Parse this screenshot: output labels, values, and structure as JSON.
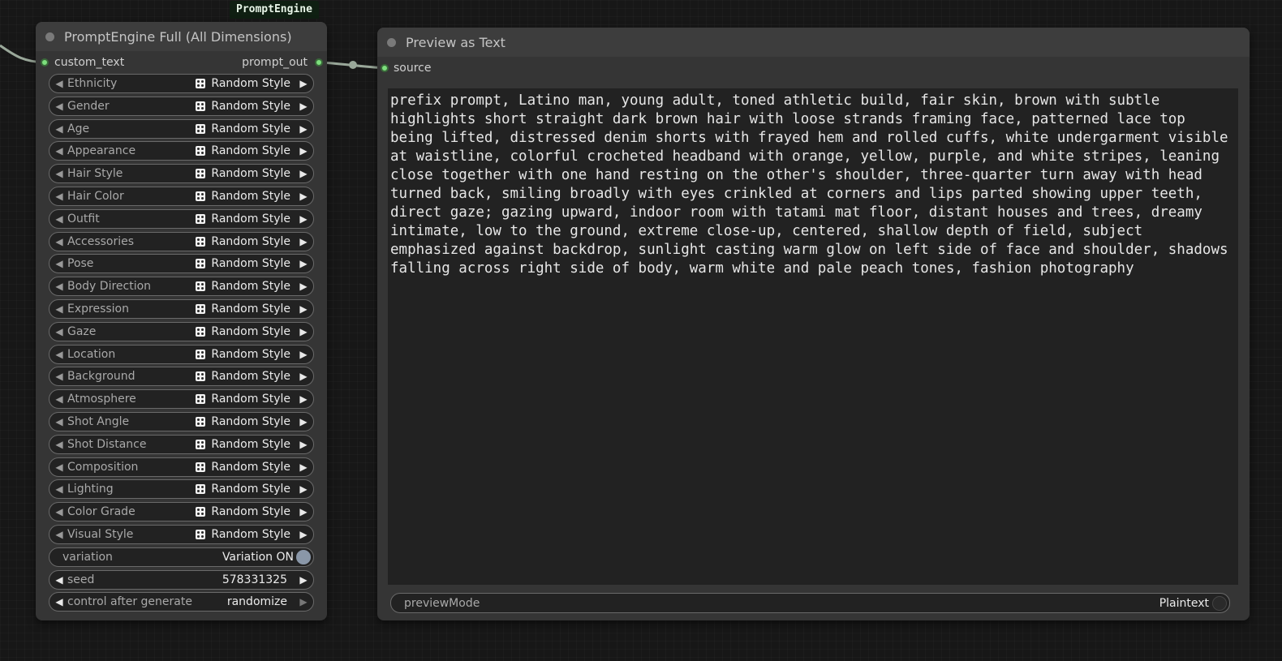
{
  "nodes": {
    "prompt_engine": {
      "badge": "PromptEngine",
      "title": "PromptEngine Full (All Dimensions)",
      "input_label": "custom_text",
      "output_label": "prompt_out",
      "combo_widgets": [
        {
          "label": "Ethnicity",
          "value": "Random Style"
        },
        {
          "label": "Gender",
          "value": "Random Style"
        },
        {
          "label": "Age",
          "value": "Random Style"
        },
        {
          "label": "Appearance",
          "value": "Random Style"
        },
        {
          "label": "Hair Style",
          "value": "Random Style"
        },
        {
          "label": "Hair Color",
          "value": "Random Style"
        },
        {
          "label": "Outfit",
          "value": "Random Style"
        },
        {
          "label": "Accessories",
          "value": "Random Style"
        },
        {
          "label": "Pose",
          "value": "Random Style"
        },
        {
          "label": "Body Direction",
          "value": "Random Style"
        },
        {
          "label": "Expression",
          "value": "Random Style"
        },
        {
          "label": "Gaze",
          "value": "Random Style"
        },
        {
          "label": "Location",
          "value": "Random Style"
        },
        {
          "label": "Background",
          "value": "Random Style"
        },
        {
          "label": "Atmosphere",
          "value": "Random Style"
        },
        {
          "label": "Shot Angle",
          "value": "Random Style"
        },
        {
          "label": "Shot Distance",
          "value": "Random Style"
        },
        {
          "label": "Composition",
          "value": "Random Style"
        },
        {
          "label": "Lighting",
          "value": "Random Style"
        },
        {
          "label": "Color Grade",
          "value": "Random Style"
        },
        {
          "label": "Visual Style",
          "value": "Random Style"
        }
      ],
      "variation": {
        "label": "variation",
        "value": "Variation ON"
      },
      "seed": {
        "label": "seed",
        "value": "578331325"
      },
      "control_after_generate": {
        "label": "control after generate",
        "value": "randomize"
      }
    },
    "preview_text": {
      "title": "Preview as Text",
      "input_label": "source",
      "text": "prefix prompt, Latino man, young adult, toned athletic build, fair skin, brown with subtle highlights short straight dark brown hair with loose strands framing face, patterned lace top being lifted, distressed denim shorts with frayed hem and rolled cuffs, white undergarment visible at waistline, colorful crocheted headband with orange, yellow, purple, and white stripes, leaning close together with one hand resting on the other's shoulder, three-quarter turn away with head turned back, smiling broadly with eyes crinkled at corners and lips parted showing upper teeth, direct gaze; gazing upward, indoor room with tatami mat floor, distant houses and trees, dreamy intimate, low to the ground, extreme close-up, centered, shallow depth of field, subject emphasized against backdrop, sunlight casting warm glow on left side of face and shoulder, shadows falling across right side of body, warm white and pale peach tones, fashion photography",
      "preview_mode": {
        "label": "previewMode",
        "value": "Plaintext"
      }
    }
  },
  "colors": {
    "canvas": "#171717",
    "node_body": "#353535",
    "slot_active": "#7ddf7d",
    "link": "#9aa89a",
    "badge_bg": "#0f1f12"
  }
}
